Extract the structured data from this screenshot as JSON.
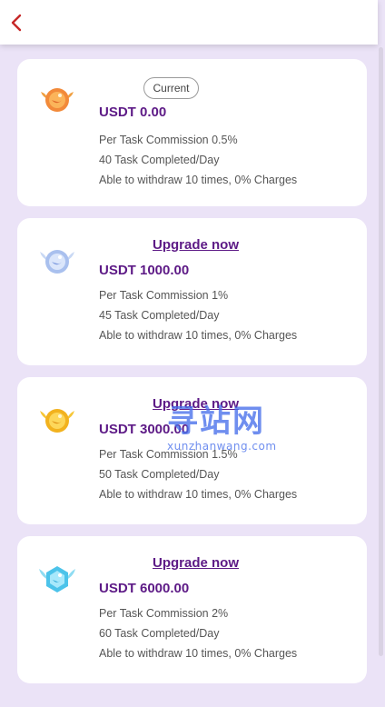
{
  "header": {
    "back_icon": "chevron-left-icon",
    "back_color": "#c62828"
  },
  "theme": {
    "background": "#ebe3f7",
    "accent": "#5d1a86",
    "card": "#ffffff"
  },
  "levels": [
    {
      "icon": "orange-wing-badge-icon",
      "tag": "Current",
      "amount": "USDT 0.00",
      "details": [
        "Per Task Commission 0.5%",
        "40 Task Completed/Day",
        "Able to withdraw 10 times, 0% Charges"
      ]
    },
    {
      "icon": "silver-wing-badge-icon",
      "action": "Upgrade now",
      "amount": "USDT 1000.00",
      "details": [
        "Per Task Commission 1%",
        "45 Task Completed/Day",
        "Able to withdraw 10 times, 0% Charges"
      ]
    },
    {
      "icon": "gold-wing-badge-icon",
      "action": "Upgrade now",
      "amount": "USDT 3000.00",
      "details": [
        "Per Task Commission 1.5%",
        "50 Task Completed/Day",
        "Able to withdraw 10 times, 0% Charges"
      ]
    },
    {
      "icon": "diamond-wing-badge-icon",
      "action": "Upgrade now",
      "amount": "USDT 6000.00",
      "details": [
        "Per Task Commission 2%",
        "60 Task Completed/Day",
        "Able to withdraw 10 times, 0% Charges"
      ]
    }
  ],
  "watermark": {
    "text": "寻站网",
    "url": "xunzhanwang.com"
  }
}
